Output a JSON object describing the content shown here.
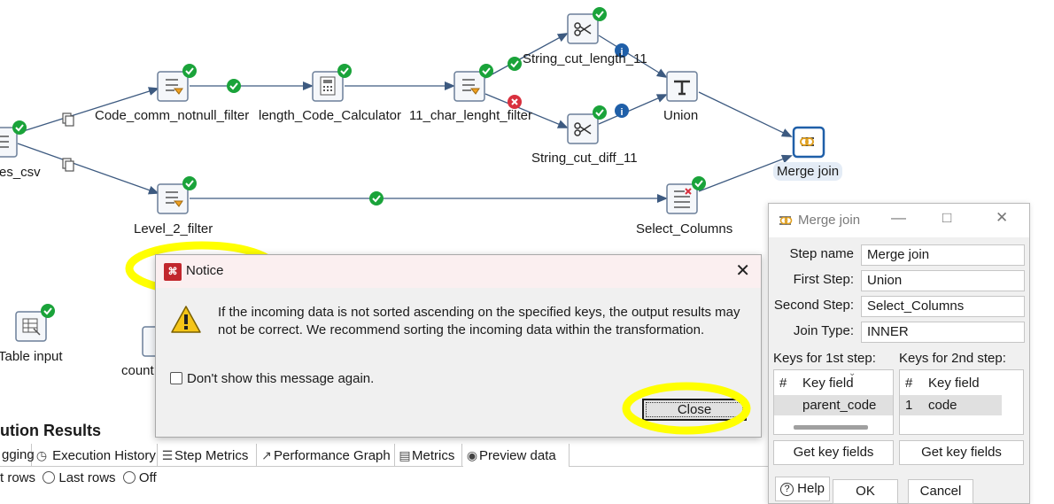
{
  "canvas": {
    "steps": {
      "csv": "es_csv",
      "code_filter": "Code_comm_notnull_filter",
      "length_calc": "length_Code_Calculator",
      "char_filter": "11_char_lenght_filter",
      "cut_length": "String_cut_length_11",
      "cut_diff": "String_cut_diff_11",
      "union": "Union",
      "merge_join": "Merge join",
      "level2_filter": "Level_2_filter",
      "select_columns": "Select_Columns",
      "table_input": "Table input",
      "count": "count"
    },
    "accent_color": "#ffff00"
  },
  "results": {
    "title": "ution Results",
    "tabs": [
      "gging",
      "Execution History",
      "Step Metrics",
      "Performance Graph",
      "Metrics",
      "Preview data"
    ],
    "radio_first": "t rows",
    "radio_last": "Last rows",
    "radio_off": "Off"
  },
  "notice": {
    "title": "Notice",
    "message": "If the incoming data is not sorted ascending on the specified keys, the output results may not be correct. We recommend sorting the incoming data within the transformation.",
    "checkbox_label": "Don't show this message again.",
    "close_label": "Close"
  },
  "merge_join_dialog": {
    "title": "Merge join",
    "step_name_label": "Step name",
    "step_name_value": "Merge join",
    "first_step_label": "First Step:",
    "first_step_value": "Union",
    "second_step_label": "Second Step:",
    "second_step_value": "Select_Columns",
    "join_type_label": "Join Type:",
    "join_type_value": "INNER",
    "keys1_label": "Keys for 1st step:",
    "keys2_label": "Keys for 2nd step:",
    "keys1": {
      "col_num": "#",
      "col_field": "Key field",
      "row_field": "parent_code"
    },
    "keys2": {
      "col_num": "#",
      "col_field": "Key field",
      "row_num": "1",
      "row_field": "code"
    },
    "get_keys_1": "Get key fields",
    "get_keys_2": "Get key fields",
    "help": "Help",
    "ok": "OK",
    "cancel": "Cancel"
  }
}
